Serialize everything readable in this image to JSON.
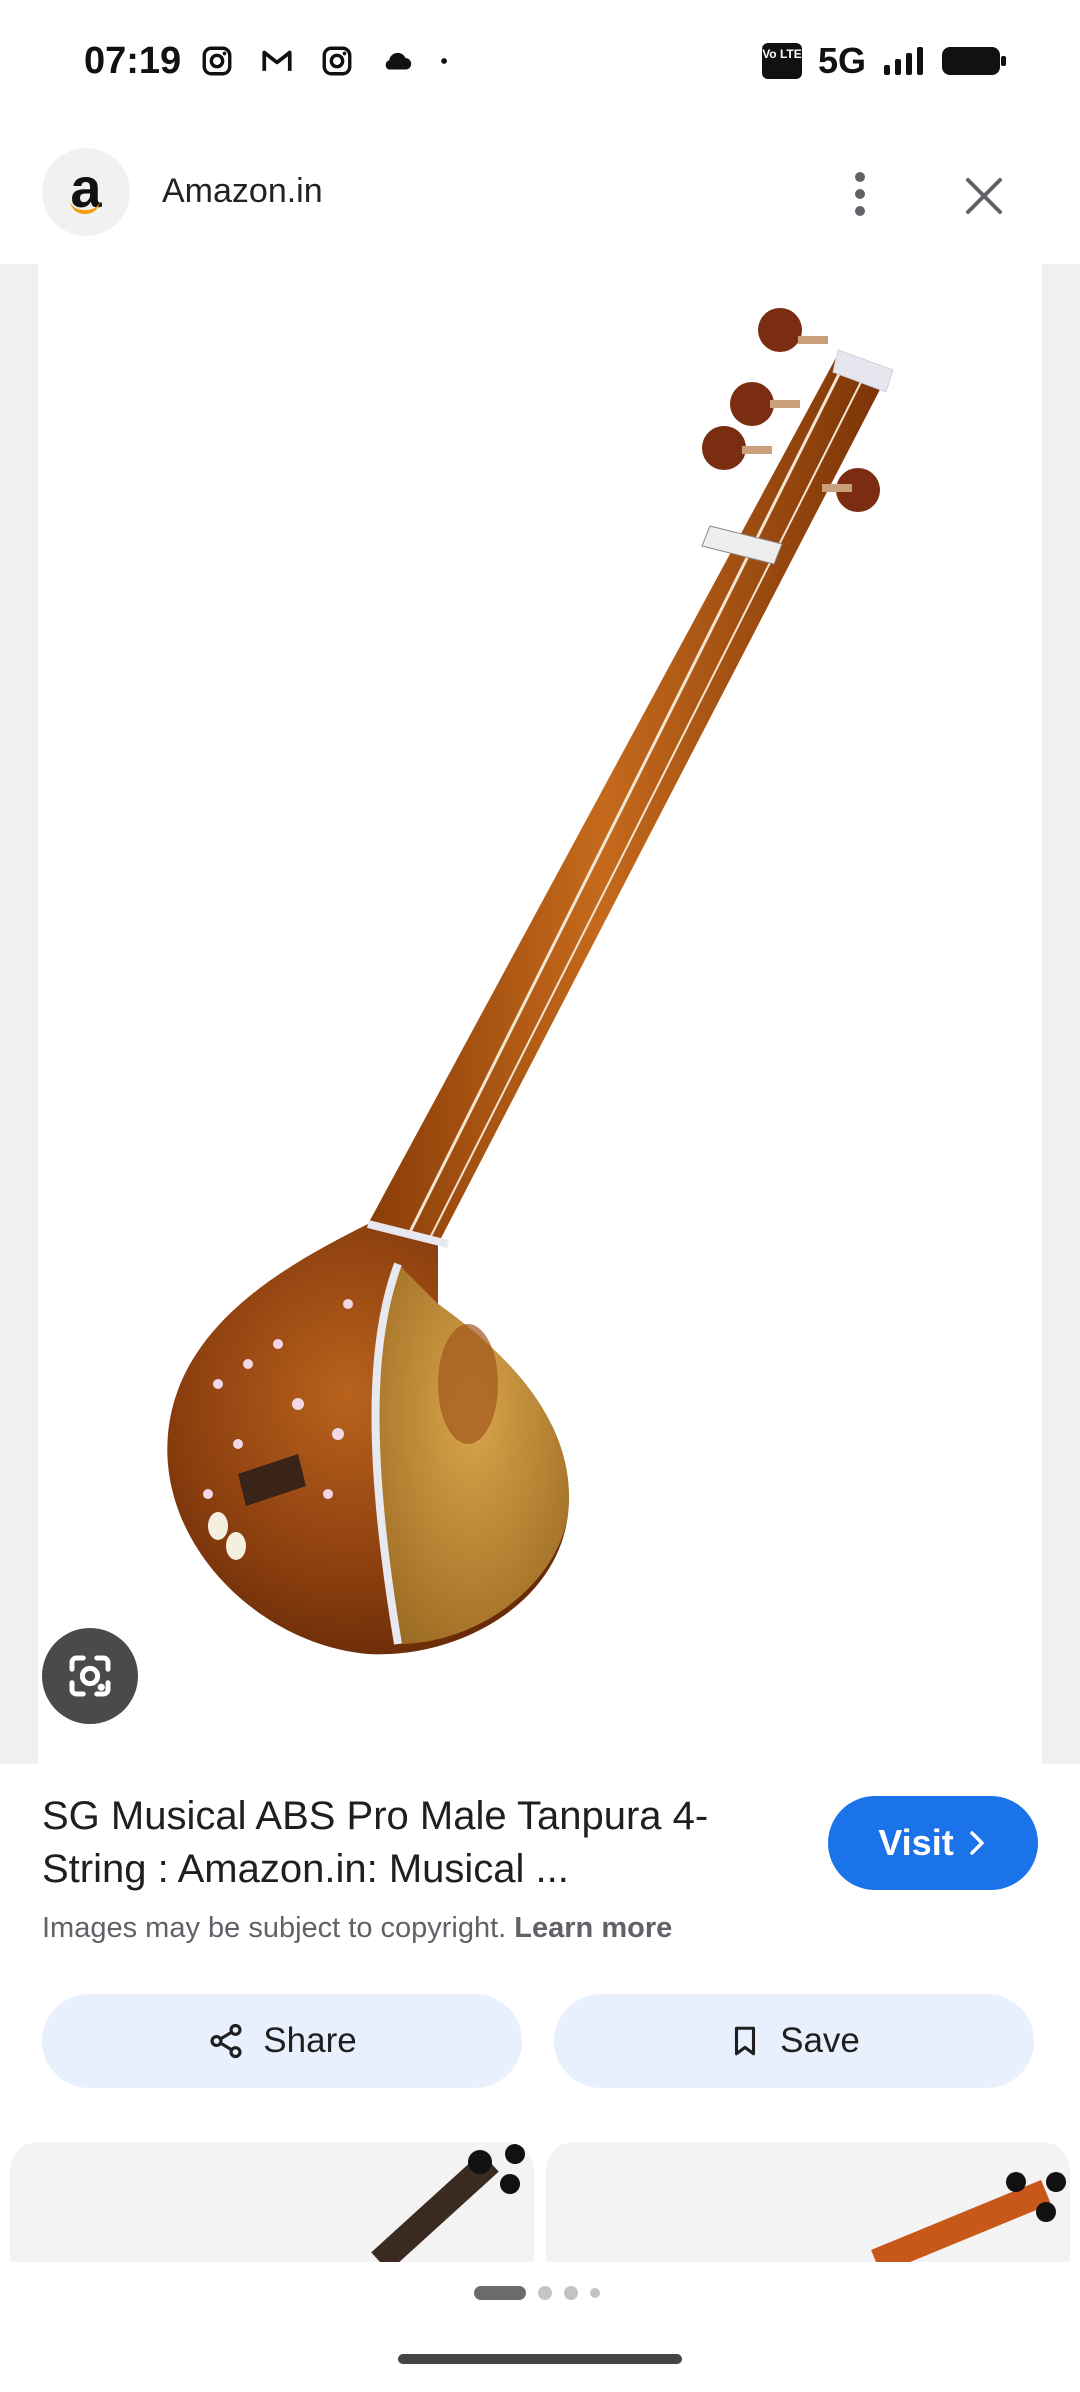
{
  "status_bar": {
    "time": "07:19",
    "left_icons": [
      "instagram-icon",
      "gmail-icon",
      "instagram-icon",
      "cloud-icon",
      "dot-icon"
    ],
    "volte_label": "Vo LTE",
    "network": "5G"
  },
  "header": {
    "site_name": "Amazon.in",
    "logo_letter": "a"
  },
  "result": {
    "title": "SG Musical ABS Pro Male Tanpura 4-String : Amazon.in: Musical ...",
    "visit_label": "Visit",
    "copyright_text": "Images may be subject to copyright.",
    "learn_more": "Learn more"
  },
  "actions": {
    "share_label": "Share",
    "save_label": "Save"
  },
  "colors": {
    "accent": "#1a73e8",
    "chip_bg": "#e8f0fe"
  }
}
